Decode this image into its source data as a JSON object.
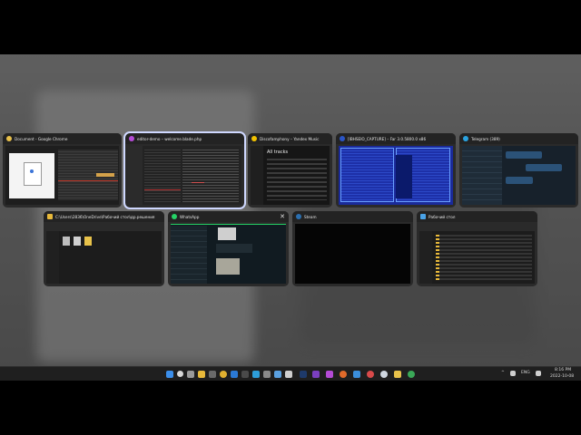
{
  "windows": [
    {
      "title": "Document - Google Chrome",
      "app": "chrome-icon",
      "color": "#e8c04a"
    },
    {
      "title": "editor-demo – welcome.blade.php",
      "app": "phpstorm-icon",
      "color": "#b44bd6"
    },
    {
      "title": "Discofamphony – Yandex Music",
      "app": "yandex-music-icon",
      "color": "#f2c200"
    },
    {
      "title": "[IBHSEIO_CAPTURE] – Far 3.0.5800.0 x86",
      "app": "far-manager-icon",
      "color": "#2b55c6"
    },
    {
      "title": "Telegram (389)",
      "app": "telegram-icon",
      "color": "#2aa3e0"
    },
    {
      "title": "C:\\Users\\2836\\OneDrive\\Рабочий стол\\др.решения",
      "app": "folder-icon",
      "color": "#e8b93a"
    },
    {
      "title": "WhatsApp",
      "app": "whatsapp-icon",
      "color": "#25d366"
    },
    {
      "title": "Steam",
      "app": "steam-icon",
      "color": "#2b6fb0"
    },
    {
      "title": "Рабочий стол",
      "app": "desktop-folder-icon",
      "color": "#4aa3e8"
    }
  ],
  "music_thumb": {
    "heading": "All tracks"
  },
  "taskbar": {
    "icons": [
      "windows-icon",
      "search-icon",
      "task-view-icon",
      "explorer-icon",
      "chrome-icon",
      "edge-icon",
      "store-icon",
      "terminal-icon",
      "phpstorm-icon",
      "yandex-music-icon",
      "steam-icon",
      "telegram-icon",
      "photoshop-icon",
      "notepad-icon",
      "whatsapp-icon",
      "far-icon",
      "folder-icon",
      "chrome-alt-icon"
    ],
    "tray": {
      "chevron": "^",
      "lang": "ENG",
      "time": "8:16 PM",
      "date": "2022-10-08"
    }
  }
}
